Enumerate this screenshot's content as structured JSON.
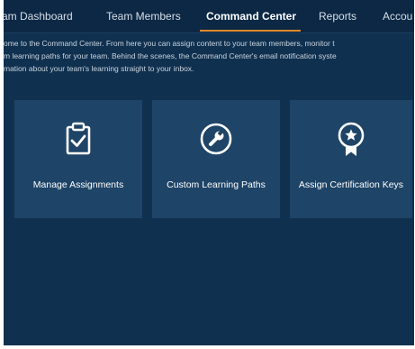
{
  "nav": {
    "tabs": [
      {
        "label": "am Dashboard"
      },
      {
        "label": "Team Members"
      },
      {
        "label": "Command Center"
      },
      {
        "label": "Reports"
      },
      {
        "label": "Accou"
      }
    ]
  },
  "intro": {
    "lines": [
      "ome to the Command Center. From here you can assign content to your team members, monitor t",
      "m learning paths for your team. Behind the scenes, the Command Center's email notification syste",
      "mation about your team's learning straight to your inbox."
    ]
  },
  "cards": [
    {
      "label": "Manage Assignments",
      "icon": "clipboard-check-icon"
    },
    {
      "label": "Custom Learning Paths",
      "icon": "wrench-icon"
    },
    {
      "label": "Assign Certification Keys",
      "icon": "award-ribbon-icon"
    }
  ],
  "colors": {
    "background": "#10304f",
    "nav_background": "#0c2845",
    "card_background": "#1e4467",
    "active_tab_underline": "#e08a2c",
    "text": "#ffffff"
  }
}
